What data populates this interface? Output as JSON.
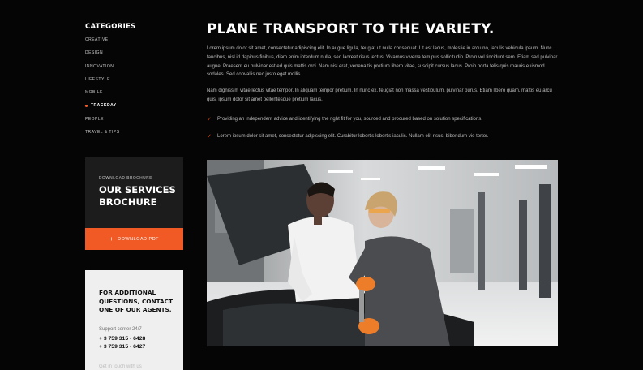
{
  "sidebar": {
    "categories_title": "CATEGORIES",
    "categories": [
      {
        "label": "CREATIVE",
        "active": false
      },
      {
        "label": "DESIGN",
        "active": false
      },
      {
        "label": "INNOVATION",
        "active": false
      },
      {
        "label": "LIFESTYLE",
        "active": false
      },
      {
        "label": "MOBILE",
        "active": false
      },
      {
        "label": "TRACKDAY",
        "active": true
      },
      {
        "label": "PEOPLE",
        "active": false
      },
      {
        "label": "TRAVEL & TIPS",
        "active": false
      }
    ],
    "brochure": {
      "eyebrow": "DOWNLOAD BROCHURE",
      "title": "OUR SERVICES BROCHURE",
      "button_label": "DOWNLOAD PDF",
      "button_icon": "plus-icon"
    },
    "contact": {
      "title": "FOR ADDITIONAL QUESTIONS, CONTACT ONE OF OUR AGENTS.",
      "support_label": "Support center 24/7",
      "phones": [
        "+ 3 759 315 - 6428",
        "+ 3 759 315 - 6427"
      ],
      "faded_text": "Get in touch with us"
    }
  },
  "article": {
    "title": "PLANE TRANSPORT TO THE VARIETY.",
    "paragraphs": [
      "Lorem ipsum dolor sit amet, consectetur adipiscing elit. In augue ligula, feugiat ut nulla consequat. Ut est lacus, molestie in arcu no, iaculis vehicula ipsum. Nunc faucibus, nisl id dapibus finibus, diam enim interdum nulla, sed laoreet risus lectus. Vivamus viverra tem pus sollicitudin. Proin vel tincidunt sem. Etiam sed pulvinar augue. Praesent eu pulvinar est ed quis mattis orci. Nam nisl erat, venena tis pretium libero vitae, suscipit cursus lacus. Proin porta felis quis mauris euismod sodales. Sed convallis nec justo eget mollis.",
      "Nam dignissim vitae lectus vitae tempor. In aliquam tempor pretium. In nunc ex, feugiat non massa vestibulum, pulvinar purus. Etiam libero quam, mattis eu arcu quis, ipsum dolor sit amet pellentesque pretium lacus."
    ],
    "checklist": [
      "Providing an independent advice and identifying the right fit for you, sourced and procured based on solution specifications.",
      "Lorem ipsum dolor sit amet, consectetur adipiscing elit. Curabitur lobortis lobortis iaculis. Nullam elit risus, bibendum vie tortor."
    ],
    "check_icon": "checkmark-icon",
    "accent_color": "#f15a24"
  }
}
